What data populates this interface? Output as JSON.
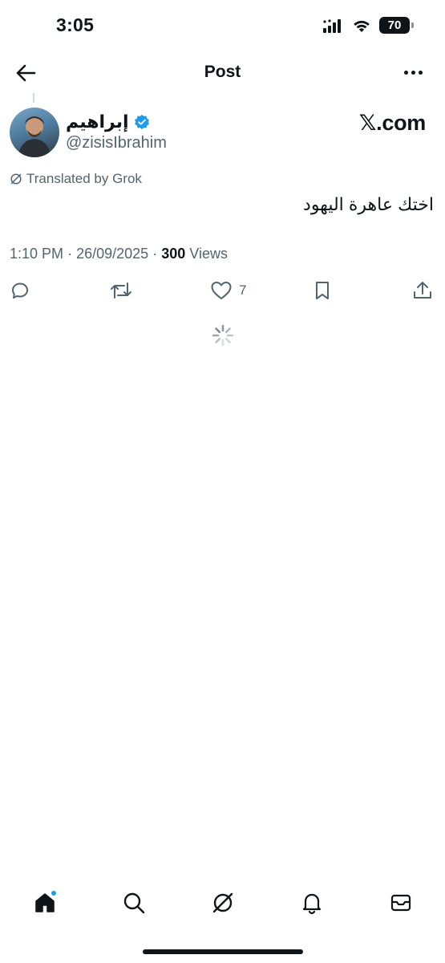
{
  "status_bar": {
    "time": "3:05",
    "battery": "70",
    "icons": [
      "signal-icon",
      "wifi-icon",
      "battery-icon"
    ]
  },
  "header": {
    "title": "Post",
    "back_icon": "arrow-left-icon",
    "more_icon": "ellipsis-icon"
  },
  "post": {
    "author_name": "إبراهيم",
    "verified": true,
    "handle": "@zisisIbrahim",
    "watermark": "𝕏.com",
    "translated_label": "Translated by Grok",
    "text": "اختك عاهرة اليهود",
    "time": "1:10 PM",
    "date": "26/09/2025",
    "separator": "·",
    "views_count": "300",
    "views_label": "Views",
    "likes_count": "7"
  },
  "actions": [
    {
      "icon": "reply-icon"
    },
    {
      "icon": "repost-icon"
    },
    {
      "icon": "like-icon",
      "count": "7"
    },
    {
      "icon": "bookmark-icon"
    },
    {
      "icon": "share-icon"
    }
  ],
  "tab_bar": {
    "tabs": [
      "home-icon",
      "search-icon",
      "grok-icon",
      "notifications-icon",
      "messages-icon"
    ],
    "home_has_notification": true
  },
  "colors": {
    "text_primary": "#0f1419",
    "text_secondary": "#536471",
    "accent": "#1d9bf0"
  }
}
